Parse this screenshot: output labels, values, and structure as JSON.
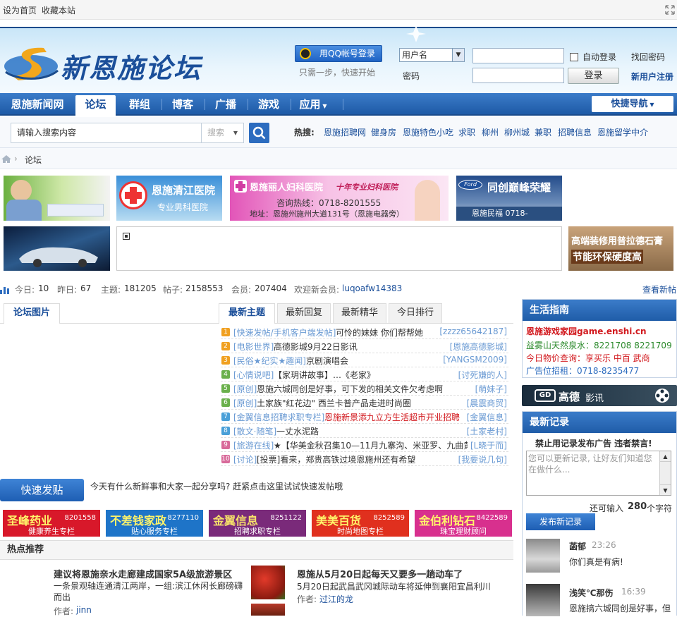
{
  "topbar": {
    "sethome": "设为首页",
    "bookmark": "收藏本站"
  },
  "header": {
    "logo_text": "新恩施论坛",
    "qq_login": "用QQ帐号登录",
    "qq_hint": "只需一步，快速开始",
    "username_select": "用户名",
    "password_label": "密码",
    "auto_login": "自动登录",
    "login_button": "登录",
    "find_password": "找回密码",
    "register": "新用户注册"
  },
  "nav": {
    "items": [
      "恩施新闻网",
      "论坛",
      "群组",
      "博客",
      "广播",
      "游戏",
      "应用"
    ],
    "quick_nav": "快捷导航"
  },
  "search": {
    "placeholder": "请输入搜索内容",
    "type": "搜索",
    "hot_label": "热搜:",
    "hot": [
      "恩施招聘网",
      "健身房",
      "恩施特色小吃",
      "求职",
      "柳州",
      "柳州城",
      "兼职",
      "招聘信息",
      "恩施留学中介"
    ]
  },
  "breadcrumb": {
    "current": "论坛"
  },
  "ads": {
    "qingjiang_title": "恩施清江医院",
    "qingjiang_sub": "专业男科医院",
    "lirens_title": "恩施丽人妇科医院",
    "lirens_slogan": "十年专业妇科医院",
    "lirens_phone": "咨询热线：0718-8201555",
    "lirens_addr": "地址：恩施州施州大道131号（恩施电器旁）",
    "ford_title": "同创巅峰荣耀",
    "ford_sub": "恩施民福  0718- 8428555",
    "ford_brand": "Ford",
    "deco_1": "高端装修用普拉德石膏",
    "deco_2": "节能环保硬度高"
  },
  "stats": {
    "today_label": "今日:",
    "today": "10",
    "yesterday_label": "昨日:",
    "yesterday": "67",
    "threads_label": "主题:",
    "threads": "181205",
    "posts_label": "帖子:",
    "posts": "2158553",
    "members_label": "会员:",
    "members": "207404",
    "welcome_label": "欢迎新会员:",
    "new_member": "luqoafw14383",
    "view_new": "查看新帖"
  },
  "tabs_left": {
    "pics": "论坛图片"
  },
  "tabs_main": [
    "最新主题",
    "最新回复",
    "最新精华",
    "今日排行"
  ],
  "threads": [
    {
      "n": "1",
      "cat": "[快速发帖/手机客户端发帖]",
      "title": "可怜的妹妹  你们帮帮她",
      "author": "[zzzz65642187]",
      "red": false
    },
    {
      "n": "2",
      "cat": "[电影世界]",
      "title": "高德影城9月22日影讯",
      "author": "[恩施高德影城]",
      "red": false
    },
    {
      "n": "3",
      "cat": "[民俗★纪实★趣闻]",
      "title": "京剧演唱会",
      "author": "[YANGSM2009]",
      "red": false
    },
    {
      "n": "4",
      "cat": "[心情说吧]",
      "title": "【家玥讲故事】…《老家》",
      "author": "[讨死嫌的人]",
      "red": false
    },
    {
      "n": "5",
      "cat": "[原创]",
      "title": "恩施六城同创是好事，可下发的相关文件欠考虑啊",
      "author": "[萌妹子]",
      "red": false
    },
    {
      "n": "6",
      "cat": "[原创]",
      "title": "土家族\"红花边\" 西兰卡普产品走进时尚圈",
      "author": "[晨震商贸]",
      "red": false
    },
    {
      "n": "7",
      "cat": "[金翼信息招聘求职专栏]",
      "title": "恩施新景添九立方生活超市开业招聘",
      "author": "[金翼信息]",
      "red": true
    },
    {
      "n": "8",
      "cat": "[散文·随笔]",
      "title": "一丈水泥路",
      "author": "[土家老村]",
      "red": false
    },
    {
      "n": "9",
      "cat": "[旅游在线]",
      "title": "★【华美金秋召集10—11月九寨沟、米亚罗、九曲黄",
      "author": "[L晓于而]",
      "red": false
    },
    {
      "n": "10",
      "cat": "[讨论]",
      "title": "[投票]看来，郑贵高铁过境恩施州还有希望",
      "author": "[我要说几句]",
      "red": false
    }
  ],
  "quickpost": {
    "button": "快速发贴",
    "prompt": "今天有什么新鲜事和大家一起分享吗? 赶紧点击这里试试快速发帖哦"
  },
  "banners": [
    {
      "name": "圣峰药业",
      "phone": "8201558",
      "sub": "健康养生专栏",
      "color": "#d8182a"
    },
    {
      "name": "不差钱家政",
      "phone": "8277110",
      "sub": "贴心服务专栏",
      "color": "#1e74c8"
    },
    {
      "name": "金翼信息",
      "phone": "8251122",
      "sub": "招聘求职专栏",
      "color": "#7a2a7a"
    },
    {
      "name": "美美百货",
      "phone": "8252589",
      "sub": "时尚地图专栏",
      "color": "#e0301e"
    },
    {
      "name": "金伯利钻石",
      "phone": "8422589",
      "sub": "珠宝理财顾问",
      "color": "#d8308e"
    }
  ],
  "hot": {
    "title": "热点推荐",
    "a1_title": "建议将恩施亲水走廊建成国家5A级旅游景区",
    "a1_text": "一条景观轴连通清江两岸，一组:滨江休闲长廊磅礴而出",
    "a1_author_label": "作者:",
    "a1_author": "jinn",
    "a2_title": "恩施从5月20日起每天又要多一趟动车了",
    "a2_text": "5月20日起武昌武冈城际动车将延伸到襄阳宜昌利川",
    "a2_author_label": "作者:",
    "a2_author": "过江的龙"
  },
  "life": {
    "title": "生活指南",
    "l1": "恩施游戏家园game.enshi.cn",
    "l2": "益雾山天然泉水：8221708 8221709",
    "l3": "今日物价查询：享买乐 中百 武商",
    "l4": "广告位招租：0718-8235477"
  },
  "gd": {
    "brand": "高德",
    "text": "影讯"
  },
  "records": {
    "title": "最新记录",
    "notice": "禁止用记录发布广告 违者禁言!",
    "placeholder": "您可以更新记录, 让好友们知道您在做什么...",
    "remain_pre": "还可输入",
    "remain": "280",
    "remain_post": "个字符",
    "publish": "发布新记录",
    "items": [
      {
        "name": "菡郁",
        "time": "23:26",
        "text": "你们真是有病!"
      },
      {
        "name": "浅笑℃那伤",
        "time": "16:39",
        "text": "恩施搞六城同创是好事，但"
      }
    ]
  }
}
